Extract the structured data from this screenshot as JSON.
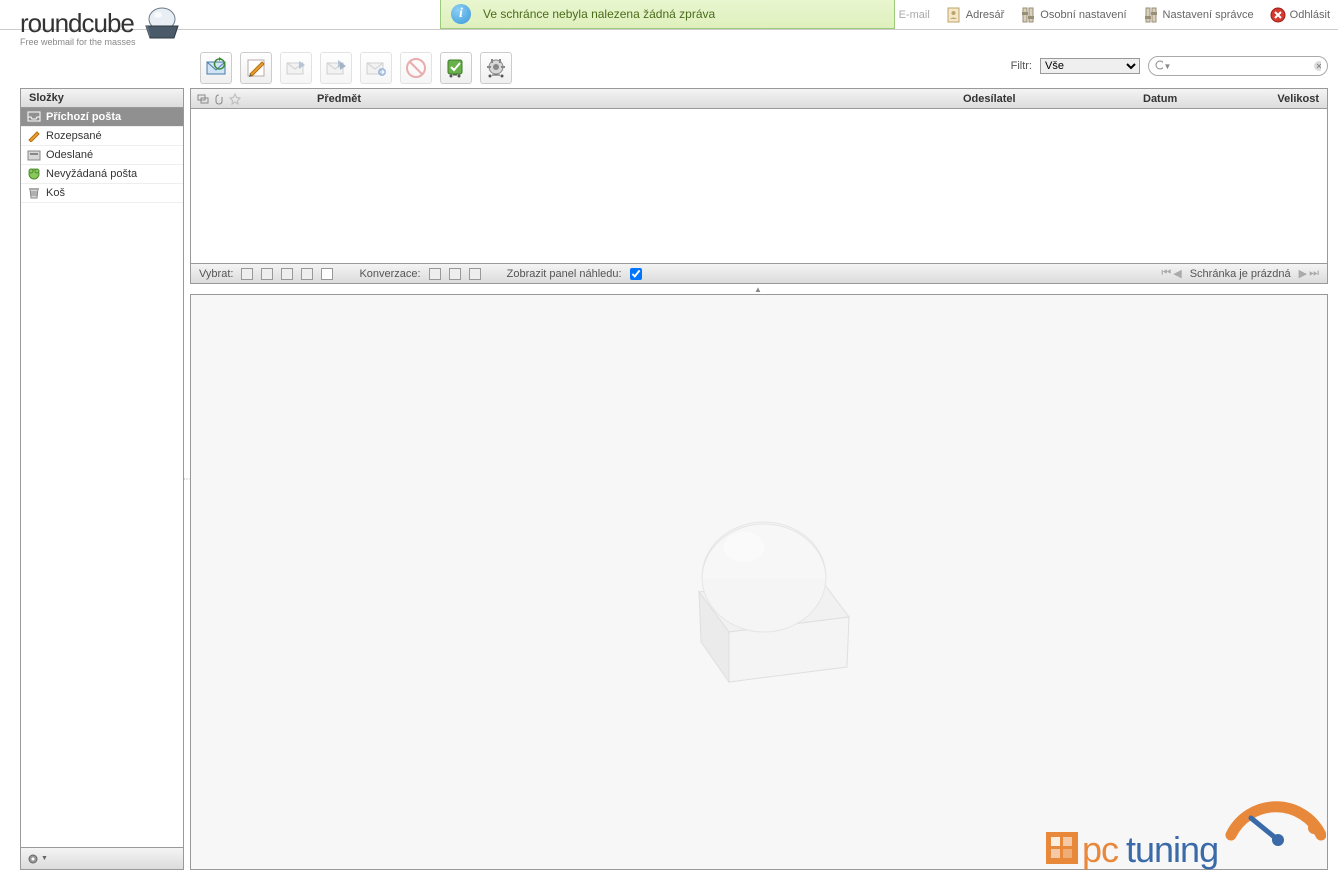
{
  "logo": {
    "name": "roundcube",
    "tagline": "Free webmail for the masses"
  },
  "notification": {
    "text": "Ve schránce nebyla nalezena žádná zpráva"
  },
  "top_links": {
    "email": "E-mail",
    "addressbook": "Adresář",
    "personal_settings": "Osobní nastavení",
    "admin_settings": "Nastavení správce",
    "logout": "Odhlásit"
  },
  "filter": {
    "label": "Filtr:",
    "selected": "Vše",
    "options": [
      "Vše"
    ]
  },
  "search": {
    "placeholder": ""
  },
  "sidebar": {
    "title": "Složky",
    "folders": [
      {
        "name": "Příchozí pošta",
        "icon": "inbox",
        "selected": true
      },
      {
        "name": "Rozepsané",
        "icon": "drafts",
        "selected": false
      },
      {
        "name": "Odeslané",
        "icon": "sent",
        "selected": false
      },
      {
        "name": "Nevyžádaná pošta",
        "icon": "junk",
        "selected": false
      },
      {
        "name": "Koš",
        "icon": "trash",
        "selected": false
      }
    ]
  },
  "message_list": {
    "columns": {
      "subject": "Předmět",
      "sender": "Odesílatel",
      "date": "Datum",
      "size": "Velikost"
    },
    "footer": {
      "select_label": "Vybrat:",
      "threads_label": "Konverzace:",
      "preview_label": "Zobrazit panel náhledu:",
      "preview_checked": true,
      "status": "Schránka je prázdná"
    }
  },
  "brand_footer": "pctuning"
}
